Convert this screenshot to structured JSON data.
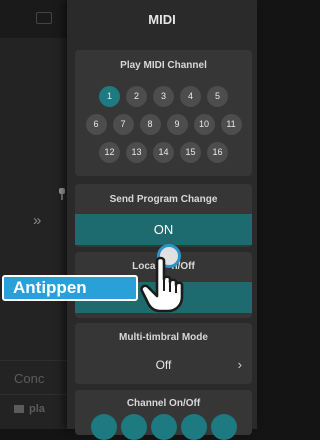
{
  "background": {
    "prev_arrow": "»",
    "concert_label": "Conc",
    "play_label": "pla"
  },
  "midi_panel": {
    "title": "MIDI",
    "play_midi_channel": {
      "title": "Play MIDI Channel",
      "channels_row1": [
        "1",
        "2",
        "3",
        "4",
        "5"
      ],
      "channels_row2": [
        "6",
        "7",
        "8",
        "9",
        "10",
        "11"
      ],
      "channels_row3": [
        "12",
        "13",
        "14",
        "15",
        "16"
      ],
      "selected_channel": "1"
    },
    "send_program_change": {
      "title": "Send Program Change",
      "value": "ON"
    },
    "local_control": {
      "title": "Local On/Off",
      "visible_title_left": "Loca",
      "visible_title_right": "n/Off"
    },
    "multi_timbral_mode": {
      "title": "Multi-timbral Mode",
      "value": "Off",
      "chevron": "›"
    },
    "channel_on_off": {
      "title": "Channel On/Off"
    }
  },
  "tap_callout": {
    "label": "Antippen"
  },
  "colors": {
    "accent_teal": "#1d6b6f",
    "selected_channel": "#1c7a80",
    "callout_blue": "#29a0d8"
  },
  "icons": [
    "hand-tap-icon",
    "chevron-right-icon",
    "double-chevron-right-icon"
  ]
}
